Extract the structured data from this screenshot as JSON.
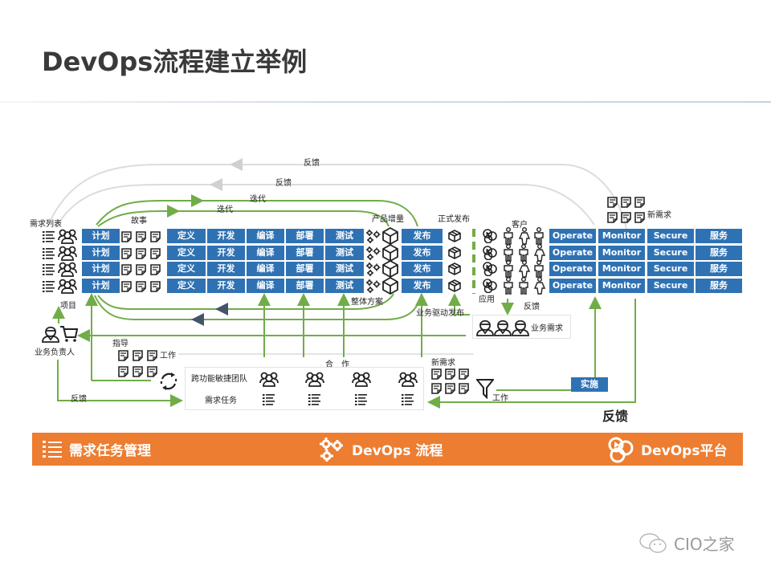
{
  "page": {
    "title": "DevOps流程建立举例"
  },
  "diagram": {
    "labels": {
      "feedback_top1": "反馈",
      "feedback_top2": "反馈",
      "iteration1": "迭代",
      "iteration2": "迭代",
      "requirements_list": "需求列表",
      "story": "故事",
      "product_increment": "产品增量",
      "official_release": "正式发布",
      "customer": "客户",
      "new_requirement_top": "新需求",
      "project": "项目",
      "overall_solution": "整体方案",
      "business_driven_release": "业务驱动发布",
      "application": "应用",
      "feedback_app": "反馈",
      "business_requirement": "业务需求",
      "business_owner": "业务负责人",
      "guidance": "指导",
      "work_left": "工作",
      "cooperation": "合　作",
      "new_requirement_bottom": "新需求",
      "cross_functional_team": "跨功能敏捷团队",
      "requirement_task": "需求任务",
      "work_right": "工作",
      "feedback_left": "反馈",
      "implement": "实施",
      "feedback_big": "反馈"
    },
    "rows": [
      {
        "plan": "计划",
        "define": "定义",
        "develop": "开发",
        "compile": "编译",
        "deploy": "部署",
        "test": "测试",
        "release": "发布",
        "operate": "Operate",
        "monitor": "Monitor",
        "secure": "Secure",
        "service": "服务"
      },
      {
        "plan": "计划",
        "define": "定义",
        "develop": "开发",
        "compile": "编译",
        "deploy": "部署",
        "test": "测试",
        "release": "发布",
        "operate": "Operate",
        "monitor": "Monitor",
        "secure": "Secure",
        "service": "服务"
      },
      {
        "plan": "计划",
        "define": "定义",
        "develop": "开发",
        "compile": "编译",
        "deploy": "部署",
        "test": "测试",
        "release": "发布",
        "operate": "Operate",
        "monitor": "Monitor",
        "secure": "Secure",
        "service": "服务"
      },
      {
        "plan": "计划",
        "define": "定义",
        "develop": "开发",
        "compile": "编译",
        "deploy": "部署",
        "test": "测试",
        "release": "发布",
        "operate": "Operate",
        "monitor": "Monitor",
        "secure": "Secure",
        "service": "服务"
      }
    ],
    "colors": {
      "box_blue": "#2f72b4",
      "arrow_green": "#70ad47",
      "feedback_gray": "#d9d9d9",
      "banner_orange": "#ed7d31"
    }
  },
  "banner": {
    "items": [
      {
        "icon": "list-icon",
        "label": "需求任务管理"
      },
      {
        "icon": "gears-icon",
        "label": "DevOps 流程"
      },
      {
        "icon": "platform-logo-icon",
        "label": "DevOps平台"
      }
    ]
  },
  "watermark": {
    "icon": "wechat-icon",
    "text": "CIO之家"
  }
}
